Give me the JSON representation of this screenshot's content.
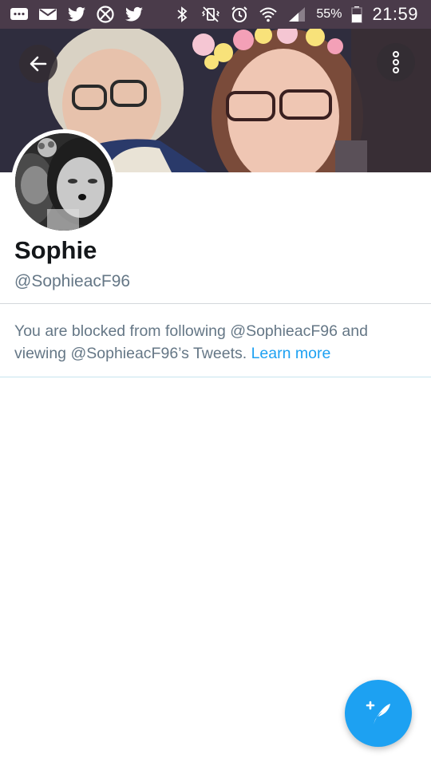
{
  "status_bar": {
    "battery_percent": "55%",
    "time": "21:59",
    "left_icons": [
      "chat-icon",
      "mail-icon",
      "twitter-icon",
      "xbox-icon",
      "twitter-icon"
    ],
    "right_icons": [
      "bluetooth-icon",
      "vibrate-icon",
      "alarm-icon",
      "wifi-icon",
      "signal-icon",
      "battery-icon"
    ]
  },
  "profile": {
    "name": "Sophie",
    "handle": "@SophieacF96"
  },
  "blocked_notice": {
    "message": "You are blocked from following @SophieacF96 and viewing @SophieacF96’s Tweets.",
    "link_label": "Learn more"
  },
  "colors": {
    "accent": "#1da1f2",
    "status_bar": "#4a3b4a",
    "secondary_text": "#657786"
  }
}
